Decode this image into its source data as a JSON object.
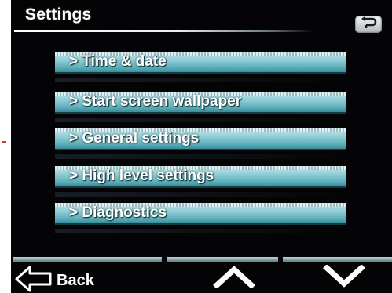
{
  "screen": {
    "title": "Settings"
  },
  "menu": {
    "items": [
      {
        "label": "> Time & date"
      },
      {
        "label": "> Start screen wallpaper"
      },
      {
        "label": "> General settings"
      },
      {
        "label": "> High level settings"
      },
      {
        "label": "> Diagnostics"
      }
    ]
  },
  "footer": {
    "back_label": "Back"
  },
  "icons": {
    "return": "return-arrow-icon",
    "back": "back-arrow-icon",
    "up": "chevron-up-icon",
    "down": "chevron-down-icon"
  },
  "colors": {
    "background": "#040406",
    "menu_bar": "#7cc3cc",
    "text": "#ffffff"
  }
}
